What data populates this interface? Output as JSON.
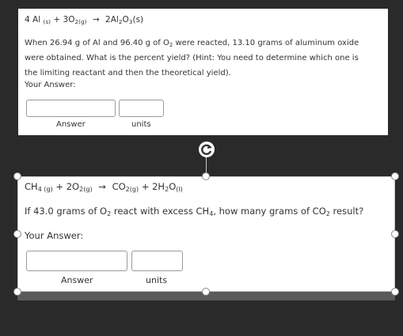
{
  "card1": {
    "equation": {
      "c1": "4 Al",
      "s1": "(s)",
      "plus": "+ 3O",
      "s2": "2(g)",
      "arrow": "→",
      "c3": "2Al",
      "s3": "2",
      "c4": "O",
      "s4": "3",
      "c5": "(s)"
    },
    "question": "When  26.94 g of Al and 96.40 g of O",
    "question_sub": "2",
    "question_rest": " were reacted, 13.10 grams of aluminum oxide were obtained. What is the percent yield? (Hint: You need to determine which one is the limiting reactant and then the theoretical yield).",
    "your_answer": "Your Answer:",
    "answer_value": "",
    "units_value": "",
    "answer_label": "Answer",
    "units_label": "units"
  },
  "card2": {
    "equation": {
      "c1": "CH",
      "s1": "4 (g)",
      "c2": "+ 2O",
      "s2": "2(g)",
      "arrow": "→",
      "c3": "CO",
      "s3": "2(g)",
      "c4": "+ 2H",
      "s4": "2",
      "c5": "O",
      "s5": "(l)"
    },
    "q_a": "If 43.0 grams of  O",
    "q_s1": "2",
    "q_b": " react with excess CH",
    "q_s2": "4",
    "q_c": ", how many grams of CO",
    "q_s3": "2",
    "q_d": " result?",
    "your_answer": "Your Answer:",
    "answer_value": "",
    "units_value": "",
    "answer_label": "Answer",
    "units_label": "units"
  },
  "icons": {
    "rotate": "rotate-icon",
    "handle": "resize-handle"
  }
}
